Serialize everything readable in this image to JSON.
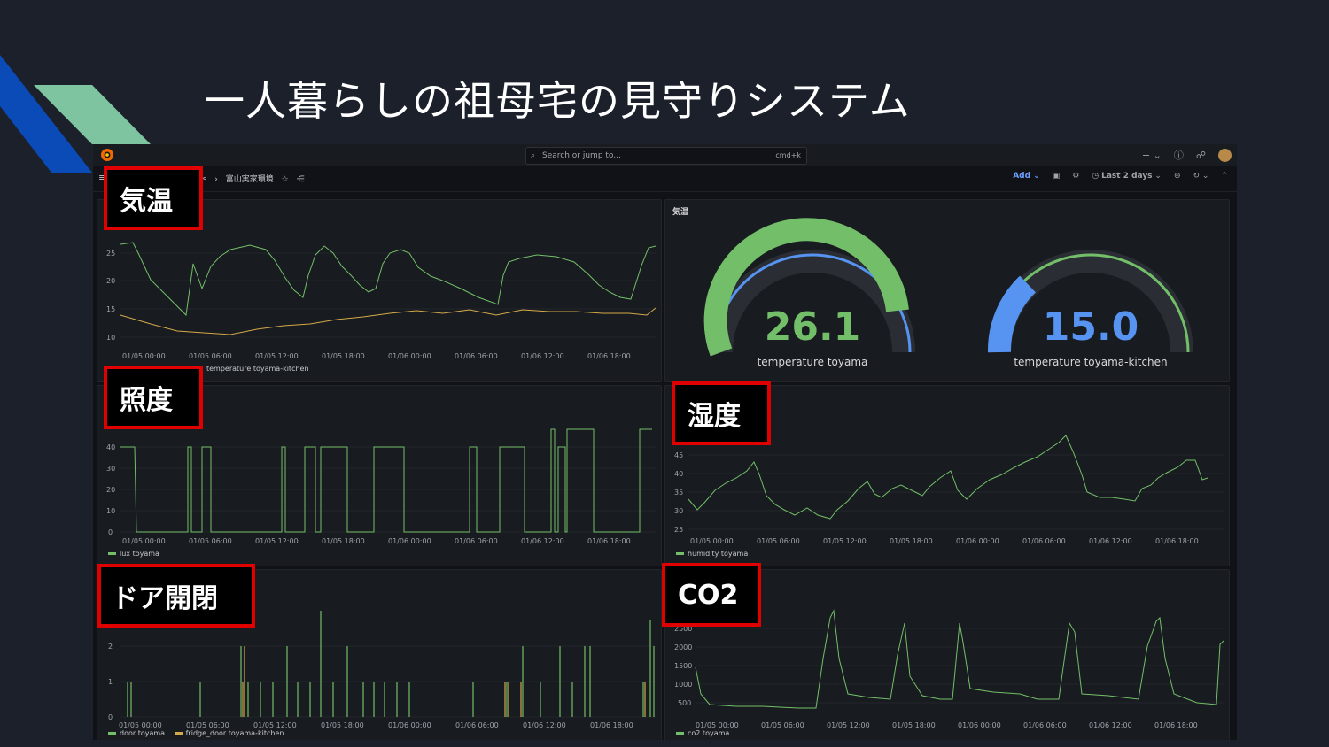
{
  "slide": {
    "title": "一人暮らしの祖母宅の見守りシステム"
  },
  "topbar": {
    "search_placeholder": "Search or jump to...",
    "shortcut": "cmd+k"
  },
  "breadcrumb": {
    "items": [
      "ds",
      "›",
      "富山実家環境"
    ]
  },
  "toolbar": {
    "add_label": "Add",
    "time_range": "Last 2 days"
  },
  "overlay_labels": {
    "temperature": "気温",
    "illuminance": "照度",
    "humidity": "湿度",
    "door": "ドア開閉",
    "co2": "CO2"
  },
  "x_ticks": [
    "01/05 00:00",
    "01/05 06:00",
    "01/05 12:00",
    "01/05 18:00",
    "01/06 00:00",
    "01/06 06:00",
    "01/06 12:00",
    "01/06 18:00"
  ],
  "panels": {
    "temp_chart": {
      "yticks": [
        "25",
        "20",
        "15",
        "10"
      ],
      "legend": "temperature toyama-kitchen"
    },
    "gauge_panel": {
      "title": "気温"
    },
    "lux_chart": {
      "yticks": [
        "40",
        "30",
        "20",
        "10",
        "0"
      ],
      "legend": "lux toyama"
    },
    "humidity_chart": {
      "yticks": [
        "45",
        "40",
        "35",
        "30",
        "25"
      ],
      "legend": "humidity toyama"
    },
    "door_chart": {
      "yticks": [
        "2",
        "1",
        "0"
      ],
      "legend1": "door toyama",
      "legend2": "fridge_door toyama-kitchen"
    },
    "co2_chart": {
      "yticks": [
        "2500",
        "2000",
        "1500",
        "1000",
        "500"
      ],
      "legend": "co2 toyama"
    }
  },
  "gauges": [
    {
      "value": "26.1",
      "label": "temperature toyama",
      "fraction": 0.86,
      "color": "#73bf69"
    },
    {
      "value": "15.0",
      "label": "temperature toyama-kitchen",
      "fraction": 0.22,
      "color": "#5794f2"
    }
  ],
  "colors": {
    "green": "#73bf69",
    "yellow": "#d4a94a",
    "blue": "#5794f2",
    "red": "#e00000"
  },
  "chart_data": [
    {
      "type": "line",
      "title": "",
      "x": [
        "01/05 00:00",
        "01/05 06:00",
        "01/05 12:00",
        "01/05 18:00",
        "01/06 00:00",
        "01/06 06:00",
        "01/06 12:00",
        "01/06 18:00"
      ],
      "series": [
        {
          "values": [
            26,
            14,
            24,
            18,
            23,
            15,
            22,
            14
          ]
        },
        {
          "name": "temperature toyama-kitchen",
          "values": [
            12.5,
            10.5,
            11.5,
            12.5,
            13.5,
            14,
            14,
            15
          ]
        }
      ],
      "ylim": [
        8,
        27
      ]
    },
    {
      "type": "line",
      "title": "",
      "series": [
        {
          "name": "lux toyama",
          "values": [
            40,
            0,
            40,
            0,
            40,
            0,
            40,
            0,
            40
          ]
        }
      ],
      "ylim": [
        0,
        45
      ]
    },
    {
      "type": "line",
      "title": "",
      "series": [
        {
          "name": "humidity toyama",
          "values": [
            30,
            40,
            29,
            35,
            38,
            34,
            43,
            33,
            40
          ]
        }
      ],
      "ylim": [
        25,
        48
      ]
    },
    {
      "type": "bar",
      "title": "",
      "series": [
        {
          "name": "door toyama"
        },
        {
          "name": "fridge_door toyama-kitchen"
        }
      ],
      "ylim": [
        0,
        2.5
      ]
    },
    {
      "type": "line",
      "title": "",
      "series": [
        {
          "name": "co2 toyama",
          "values": [
            1200,
            500,
            2300,
            550,
            2200,
            600,
            2300,
            500,
            2200
          ]
        }
      ],
      "ylim": [
        300,
        2600
      ]
    }
  ]
}
